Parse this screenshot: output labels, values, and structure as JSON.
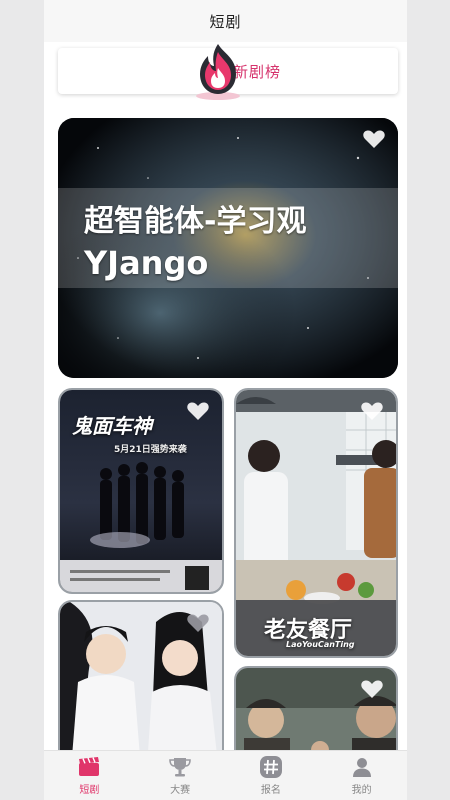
{
  "header": {
    "title": "短剧"
  },
  "rank_banner": {
    "label": "新剧榜",
    "icon": "fire-icon"
  },
  "featured": {
    "title_line1": "超智能体-学习观",
    "title_line2": "YJango"
  },
  "posters": {
    "p1": {
      "title": "鬼面车神",
      "subtitle": "5月21日强势来袭"
    },
    "p2": {
      "title": "老友餐厅",
      "subtitle": "LaoYouCanTing"
    }
  },
  "tabs": [
    {
      "label": "短剧",
      "icon": "film-clapper-icon",
      "active": true
    },
    {
      "label": "大赛",
      "icon": "trophy-icon",
      "active": false
    },
    {
      "label": "报名",
      "icon": "hashtag-icon",
      "active": false
    },
    {
      "label": "我的",
      "icon": "user-icon",
      "active": false
    }
  ],
  "colors": {
    "accent": "#e0356a",
    "inactive": "#999999"
  }
}
